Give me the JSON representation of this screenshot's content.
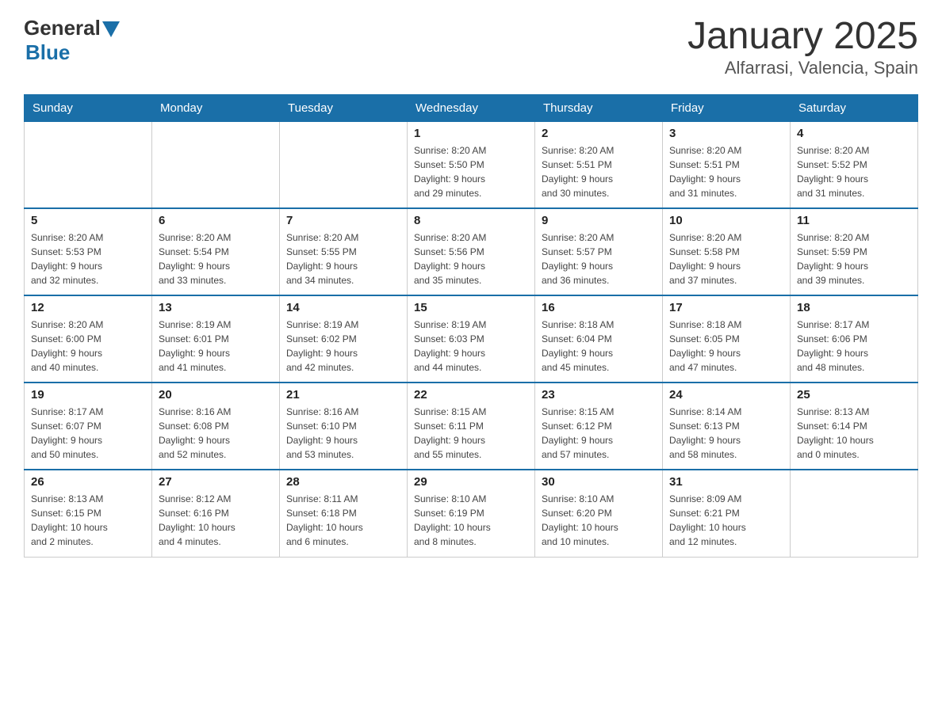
{
  "header": {
    "logo_general": "General",
    "logo_blue": "Blue",
    "title": "January 2025",
    "subtitle": "Alfarrasi, Valencia, Spain"
  },
  "days_of_week": [
    "Sunday",
    "Monday",
    "Tuesday",
    "Wednesday",
    "Thursday",
    "Friday",
    "Saturday"
  ],
  "weeks": [
    {
      "days": [
        {
          "number": "",
          "info": ""
        },
        {
          "number": "",
          "info": ""
        },
        {
          "number": "",
          "info": ""
        },
        {
          "number": "1",
          "info": "Sunrise: 8:20 AM\nSunset: 5:50 PM\nDaylight: 9 hours\nand 29 minutes."
        },
        {
          "number": "2",
          "info": "Sunrise: 8:20 AM\nSunset: 5:51 PM\nDaylight: 9 hours\nand 30 minutes."
        },
        {
          "number": "3",
          "info": "Sunrise: 8:20 AM\nSunset: 5:51 PM\nDaylight: 9 hours\nand 31 minutes."
        },
        {
          "number": "4",
          "info": "Sunrise: 8:20 AM\nSunset: 5:52 PM\nDaylight: 9 hours\nand 31 minutes."
        }
      ]
    },
    {
      "days": [
        {
          "number": "5",
          "info": "Sunrise: 8:20 AM\nSunset: 5:53 PM\nDaylight: 9 hours\nand 32 minutes."
        },
        {
          "number": "6",
          "info": "Sunrise: 8:20 AM\nSunset: 5:54 PM\nDaylight: 9 hours\nand 33 minutes."
        },
        {
          "number": "7",
          "info": "Sunrise: 8:20 AM\nSunset: 5:55 PM\nDaylight: 9 hours\nand 34 minutes."
        },
        {
          "number": "8",
          "info": "Sunrise: 8:20 AM\nSunset: 5:56 PM\nDaylight: 9 hours\nand 35 minutes."
        },
        {
          "number": "9",
          "info": "Sunrise: 8:20 AM\nSunset: 5:57 PM\nDaylight: 9 hours\nand 36 minutes."
        },
        {
          "number": "10",
          "info": "Sunrise: 8:20 AM\nSunset: 5:58 PM\nDaylight: 9 hours\nand 37 minutes."
        },
        {
          "number": "11",
          "info": "Sunrise: 8:20 AM\nSunset: 5:59 PM\nDaylight: 9 hours\nand 39 minutes."
        }
      ]
    },
    {
      "days": [
        {
          "number": "12",
          "info": "Sunrise: 8:20 AM\nSunset: 6:00 PM\nDaylight: 9 hours\nand 40 minutes."
        },
        {
          "number": "13",
          "info": "Sunrise: 8:19 AM\nSunset: 6:01 PM\nDaylight: 9 hours\nand 41 minutes."
        },
        {
          "number": "14",
          "info": "Sunrise: 8:19 AM\nSunset: 6:02 PM\nDaylight: 9 hours\nand 42 minutes."
        },
        {
          "number": "15",
          "info": "Sunrise: 8:19 AM\nSunset: 6:03 PM\nDaylight: 9 hours\nand 44 minutes."
        },
        {
          "number": "16",
          "info": "Sunrise: 8:18 AM\nSunset: 6:04 PM\nDaylight: 9 hours\nand 45 minutes."
        },
        {
          "number": "17",
          "info": "Sunrise: 8:18 AM\nSunset: 6:05 PM\nDaylight: 9 hours\nand 47 minutes."
        },
        {
          "number": "18",
          "info": "Sunrise: 8:17 AM\nSunset: 6:06 PM\nDaylight: 9 hours\nand 48 minutes."
        }
      ]
    },
    {
      "days": [
        {
          "number": "19",
          "info": "Sunrise: 8:17 AM\nSunset: 6:07 PM\nDaylight: 9 hours\nand 50 minutes."
        },
        {
          "number": "20",
          "info": "Sunrise: 8:16 AM\nSunset: 6:08 PM\nDaylight: 9 hours\nand 52 minutes."
        },
        {
          "number": "21",
          "info": "Sunrise: 8:16 AM\nSunset: 6:10 PM\nDaylight: 9 hours\nand 53 minutes."
        },
        {
          "number": "22",
          "info": "Sunrise: 8:15 AM\nSunset: 6:11 PM\nDaylight: 9 hours\nand 55 minutes."
        },
        {
          "number": "23",
          "info": "Sunrise: 8:15 AM\nSunset: 6:12 PM\nDaylight: 9 hours\nand 57 minutes."
        },
        {
          "number": "24",
          "info": "Sunrise: 8:14 AM\nSunset: 6:13 PM\nDaylight: 9 hours\nand 58 minutes."
        },
        {
          "number": "25",
          "info": "Sunrise: 8:13 AM\nSunset: 6:14 PM\nDaylight: 10 hours\nand 0 minutes."
        }
      ]
    },
    {
      "days": [
        {
          "number": "26",
          "info": "Sunrise: 8:13 AM\nSunset: 6:15 PM\nDaylight: 10 hours\nand 2 minutes."
        },
        {
          "number": "27",
          "info": "Sunrise: 8:12 AM\nSunset: 6:16 PM\nDaylight: 10 hours\nand 4 minutes."
        },
        {
          "number": "28",
          "info": "Sunrise: 8:11 AM\nSunset: 6:18 PM\nDaylight: 10 hours\nand 6 minutes."
        },
        {
          "number": "29",
          "info": "Sunrise: 8:10 AM\nSunset: 6:19 PM\nDaylight: 10 hours\nand 8 minutes."
        },
        {
          "number": "30",
          "info": "Sunrise: 8:10 AM\nSunset: 6:20 PM\nDaylight: 10 hours\nand 10 minutes."
        },
        {
          "number": "31",
          "info": "Sunrise: 8:09 AM\nSunset: 6:21 PM\nDaylight: 10 hours\nand 12 minutes."
        },
        {
          "number": "",
          "info": ""
        }
      ]
    }
  ]
}
